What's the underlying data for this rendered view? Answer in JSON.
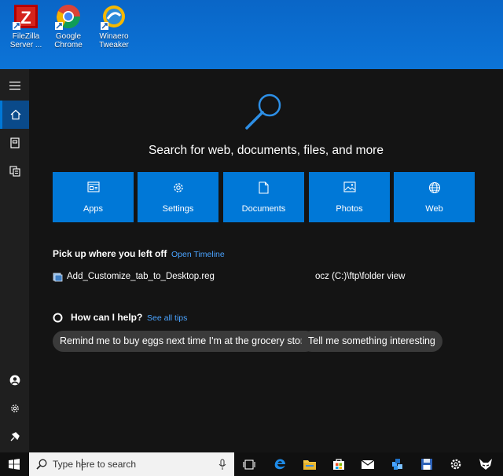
{
  "desktop": {
    "icons": [
      {
        "label_line1": "FileZilla",
        "label_line2": "Server ..."
      },
      {
        "label_line1": "Google",
        "label_line2": "Chrome"
      },
      {
        "label_line1": "Winaero",
        "label_line2": "Tweaker"
      }
    ]
  },
  "search_panel": {
    "heading": "Search for web, documents, files, and more",
    "categories": [
      {
        "label": "Apps",
        "icon": "apps-icon"
      },
      {
        "label": "Settings",
        "icon": "gear-icon"
      },
      {
        "label": "Documents",
        "icon": "document-icon"
      },
      {
        "label": "Photos",
        "icon": "photo-icon"
      },
      {
        "label": "Web",
        "icon": "globe-icon"
      }
    ],
    "timeline": {
      "title": "Pick up where you left off",
      "link": "Open Timeline",
      "item_name": "Add_Customize_tab_to_Desktop.reg",
      "item_location": "ocz (C:)\\ftp\\folder view"
    },
    "help": {
      "title": "How can I help?",
      "link": "See all tips",
      "suggestions": [
        "Remind me to buy eggs next time I'm at the grocery store",
        "Tell me something interesting"
      ]
    }
  },
  "taskbar": {
    "search_placeholder": "Type here to search"
  },
  "colors": {
    "accent": "#0078d7",
    "link": "#4aa3ff",
    "panel_bg": "#141414",
    "rail_bg": "#1f1f1f",
    "pill_bg": "#3a3a3a"
  }
}
